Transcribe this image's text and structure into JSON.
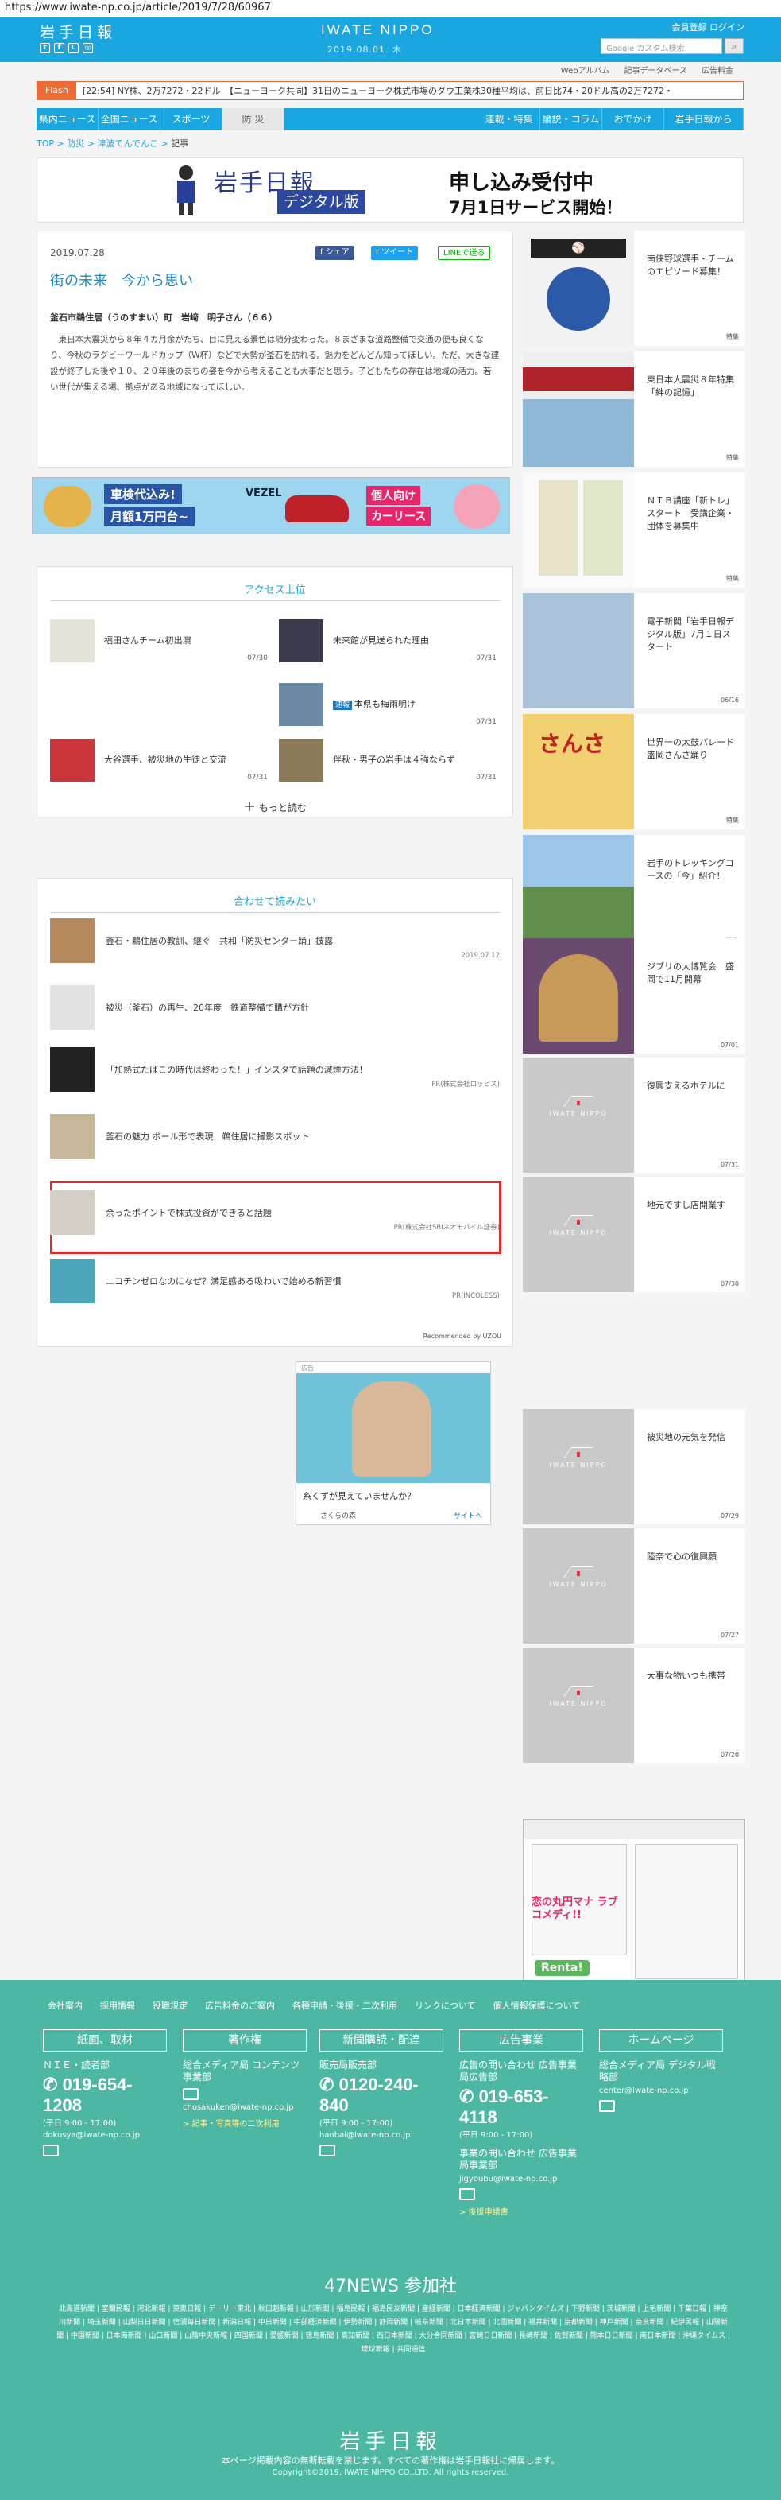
{
  "url": "https://www.iwate-np.co.jp/article/2019/7/28/60967",
  "header": {
    "logo_text": "岩手日報",
    "title": "IWATE NIPPO",
    "date": "2019.08.01. 木",
    "member_links": "会員登録 ログイン",
    "search_placeholder": "Google カスタム検索",
    "sublinks": [
      "Webアルバム",
      "記事データベース",
      "広告料金"
    ]
  },
  "flash": {
    "label": "Flash",
    "text": "[22:54] NY株、2万7272・22ドル　【ニューヨーク共同】31日のニューヨーク株式市場のダウ工業株30種平均は、前日比74・20ドル高の2万7272・"
  },
  "nav": [
    "県内ニュース",
    "全国ニュース",
    "スポーツ",
    "防 災",
    "連載・特集",
    "論説・コラム",
    "おでかけ",
    "岩手日報から"
  ],
  "nav_active": 3,
  "breadcrumb": {
    "items": [
      "TOP",
      "防災",
      "津波てんでんこ"
    ],
    "current": "記事"
  },
  "banner": {
    "logo": "岩手日報",
    "digital": "デジタル版",
    "main": "申し込み受付中",
    "sub": "7月1日サービス開始！"
  },
  "article": {
    "date": "2019.07.28",
    "title": "街の未来　今から思い",
    "share": {
      "facebook": "シェア",
      "twitter": "ツイート",
      "line": "LINEで送る"
    },
    "byline": "釜石市鵜住居（うのすまい）町　岩﨑　明子さん（６６）",
    "body": "　東日本大震災から８年４カ月余がたち、目に見える景色は随分変わった。８まざまな道路整備で交通の便も良くなり、今秋のラグビーワールドカップ（Ｗ杯）などで大勢が釜石を訪れる。魅力をどんどん知ってほしい。ただ、大きな建設が終了した後や１０、２０年後のまちの姿を今から考えることも大事だと思う。子どもたちの存在は地域の活力。若い世代が集える場、拠点がある地域になってほしい。"
  },
  "ad_car": {
    "line1": "車検代込み!",
    "line2": "月額1万円台~",
    "brand": "VEZEL",
    "tag": "個人向け",
    "tag2": "カーリース"
  },
  "access": {
    "title": "アクセス上位",
    "items": [
      {
        "title": "福田さんチーム初出演",
        "date": "07/30"
      },
      {
        "title": "未来館が見送られた理由",
        "date": "07/31"
      },
      {
        "badge": "速報",
        "title": "本県も梅雨明け",
        "date": "07/31"
      },
      {
        "title": "大谷選手、被災地の生徒と交流",
        "date": "07/31"
      },
      {
        "title": "伴秋・男子の岩手は４強ならず",
        "date": "07/31"
      }
    ],
    "more": "もっと読む"
  },
  "related": {
    "title": "合わせて読みたい",
    "items": [
      {
        "title": "釜石・鵜住居の教訓、継ぐ　共和「防災センター踊」披露",
        "pr": "2019.07.12"
      },
      {
        "title": "被災（釜石）の再生、20年度　鉄道整備で購が方針",
        "pr": ""
      },
      {
        "title": "「加熱式たばこの時代は終わった！」インスタで話題の減煙方法！",
        "pr": "PR(株式会社ロッピス)"
      },
      {
        "title": "釜石の魅力 ポール形で表現　鵜住居に撮影スポット",
        "pr": ""
      },
      {
        "title": "余ったポイントで株式投資ができると話題",
        "pr": "PR(株式会社SBIネオモバイル証券)"
      },
      {
        "title": "ニコチンゼロなのになぜ？満足感ある吸わいで始める新習慣",
        "pr": "PR(INCOLESS)"
      }
    ],
    "recommend": "Recommended by UZOU"
  },
  "ad_grandma": {
    "label": "広告",
    "caption": "糸くずが見えていませんか？",
    "source": "さくらの森",
    "link": "サイトへ"
  },
  "sidebar": [
    {
      "title": "南侠野球選手・チームのエピソード募集！",
      "date": "特集"
    },
    {
      "title": "東日本大震災８年特集「絆の記憶」",
      "date": "特集"
    },
    {
      "title": "ＮＩＢ講座「新トレ」スタート　受講企業・団体を募集中",
      "date": "特集"
    },
    {
      "title": "電子新聞「岩手日報デジタル版」7月１日スタート",
      "date": "06/16"
    },
    {
      "title": "世界一の太鼓パレード　盛岡さんさ踊り",
      "date": "特集"
    },
    {
      "title": "岩手のトレッキングコースの「今」紹介！",
      "date": "特集"
    },
    {
      "title": "ジブリの大博覧会　盛岡で11月開幕",
      "date": "07/01"
    },
    {
      "title": "復興支えるホテルに",
      "date": "07/31"
    },
    {
      "title": "地元ですし店開業す",
      "date": "07/30"
    },
    {
      "title": "被災地の元気を発信",
      "date": "07/29"
    },
    {
      "title": "陸奈で心の復興願",
      "date": "07/27"
    },
    {
      "title": "大事な物いつも携帯",
      "date": "07/26"
    }
  ],
  "manga": {
    "title": "恋の丸円マナ ラブコメディ!!",
    "brand": "Renta!"
  },
  "footer": {
    "links": [
      "会社案内",
      "採用情報",
      "役職規定",
      "広告料金のご案内",
      "各種申請・後援・二次利用",
      "リンクについて",
      "個人情報保護について"
    ],
    "cols": [
      {
        "head": "紙面、取材",
        "sub": "ＮＩＥ・読者部",
        "tel": "019-654-1208",
        "hours": "(平日 9:00 - 17:00)",
        "mail": "dokusya@iwate-np.co.jp"
      },
      {
        "head": "著作権",
        "sub": "総合メディア局 コンテンツ事業部",
        "mail": "chosakuken@iwate-np.co.jp",
        "note": "> 記事・写真等の二次利用"
      },
      {
        "head": "新聞購読・配達",
        "sub": "販売局販売部",
        "tel": "0120-240-840",
        "hours": "(平日 9:00 - 17:00)",
        "mail": "hanbai@iwate-np.co.jp"
      },
      {
        "head": "広告事業",
        "sub": "広告の問い合わせ 広告事業局広告部",
        "tel": "019-653-4118",
        "hours": "(平日 9:00 - 17:00)",
        "sub2": "事業の問い合わせ 広告事業局事業部",
        "mail": "jigyoubu@iwate-np.co.jp",
        "note": "> 後援申請書"
      },
      {
        "head": "ホームページ",
        "sub": "総合メディア局 デジタル戦略部",
        "mail": "center@iwate-np.co.jp"
      }
    ],
    "news47": "47NEWS 参加社",
    "papers": "北海道新聞 | 室蘭民報 | 河北新報 | 東奥日報 | デーリー東北 | 秋田魁新報 | 山形新聞 | 福島民報 | 福島民友新聞 | 産経新聞 | 日本経済新聞 | ジャパンタイムズ | 下野新聞 | 茨城新聞 | 上毛新聞 | 千葉日報 | 神奈川新聞 | 埼玉新聞 | 山梨日日新聞 | 信濃毎日新聞 | 新潟日報 | 中日新聞 | 中部経済新聞 | 伊勢新聞 | 静岡新聞 | 岐阜新聞 | 北日本新聞 | 北國新聞 | 福井新聞 | 京都新聞 | 神戸新聞 | 奈良新聞 | 紀伊民報 | 山陽新聞 | 中国新聞 | 日本海新聞 | 山口新聞 | 山陰中央新報 | 四国新聞 | 愛媛新聞 | 徳島新聞 | 高知新聞 | 西日本新聞 | 大分合同新聞 | 宮崎日日新聞 | 長崎新聞 | 佐賀新聞 | 熊本日日新聞 | 南日本新聞 | 沖縄タイムス | 琉球新報 | 共同通信",
    "logo": "岩手日報",
    "desc": "本ページ掲載内容の無断転載を禁じます。すべての著作権は岩手日報社に帰属します。",
    "copyright": "Copyright©2019, IWATE NIPPO CO.,LTD. All rights reserved."
  }
}
